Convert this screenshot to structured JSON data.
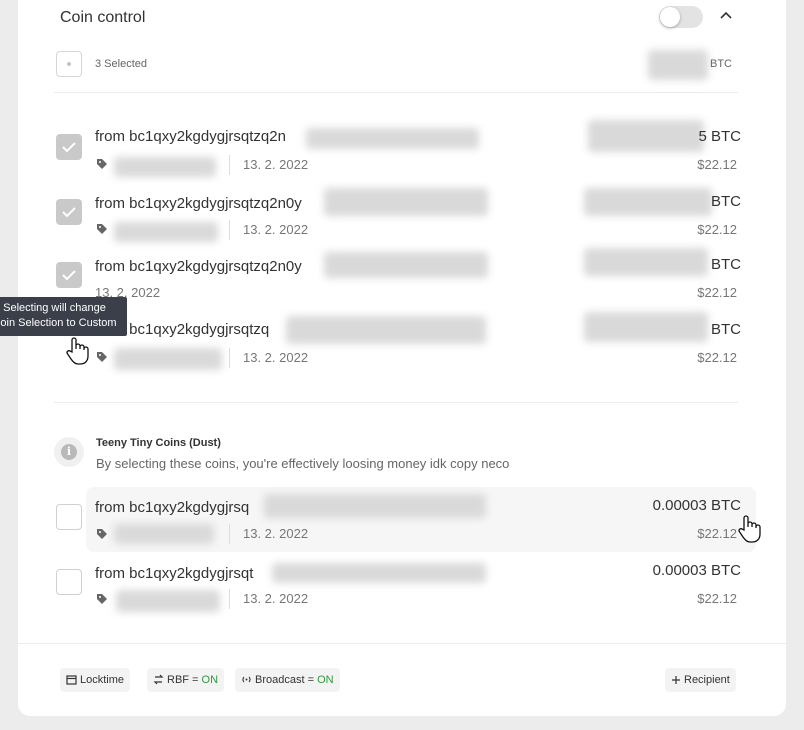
{
  "header": {
    "title": "Coin control"
  },
  "selection": {
    "count_label": "3 Selected",
    "sum_unit": "BTC"
  },
  "coins": [
    {
      "title": "from bc1qxy2kgdygjrsqtzq2n",
      "date": "13. 2. 2022",
      "btc_suffix": "5 BTC",
      "usd": "$22.12",
      "checked": true
    },
    {
      "title": "from bc1qxy2kgdygjrsqtzq2n0y",
      "date": "13. 2. 2022",
      "btc_suffix": "BTC",
      "usd": "$22.12",
      "checked": true
    },
    {
      "title": "from bc1qxy2kgdygjrsqtzq2n0y",
      "date": "13. 2. 2022",
      "btc_suffix": "BTC",
      "usd": "$22.12",
      "checked": true
    },
    {
      "title": "from bc1qxy2kgdygjrsqtzq",
      "date": "13. 2. 2022",
      "btc_suffix": "BTC",
      "usd": "$22.12",
      "checked": false
    }
  ],
  "tooltip": {
    "line1": "Selecting will change",
    "line2": "Coin Selection to Custom"
  },
  "dust": {
    "title": "Teeny Tiny Coins (Dust)",
    "description": "By selecting these coins, you're effectively loosing money idk copy neco",
    "info_icon": "i",
    "coins": [
      {
        "title": "from bc1qxy2kgdygjrsq",
        "date": "13. 2. 2022",
        "btc": "0.00003 BTC",
        "usd": "$22.12"
      },
      {
        "title": "from bc1qxy2kgdygjrsqt",
        "date": "13. 2. 2022",
        "btc": "0.00003 BTC",
        "usd": "$22.12"
      }
    ]
  },
  "footer": {
    "locktime": "Locktime",
    "rbf_label": "RBF = ",
    "rbf_value": "ON",
    "broadcast_label": "Broadcast = ",
    "broadcast_value": "ON",
    "recipient": "Recipient"
  },
  "icons": [
    "chevron-up-icon",
    "tag-icon",
    "check-icon",
    "info-icon",
    "calendar-icon",
    "swap-icon",
    "broadcast-icon",
    "plus-icon",
    "hand-cursor-icon"
  ],
  "colors": {
    "on": "#2e9a3a",
    "tooltip_bg": "#3b3f4a",
    "checked": "#c9c9c9"
  }
}
